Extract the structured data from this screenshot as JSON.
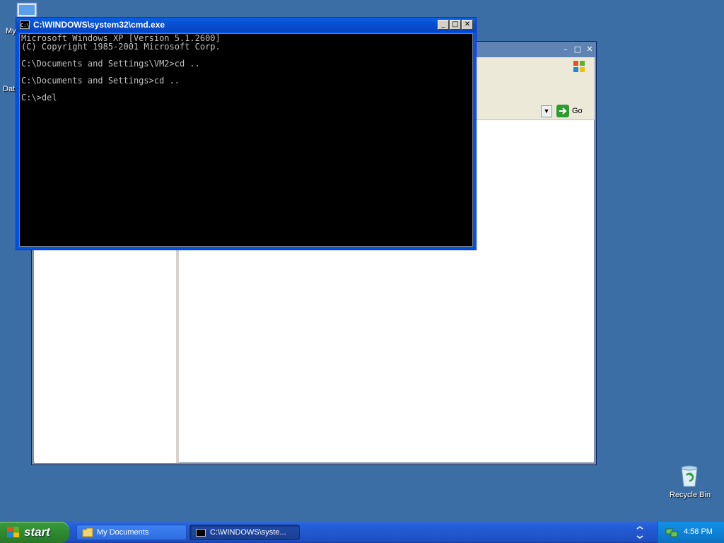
{
  "desktop": {
    "icons": [
      {
        "label": "My"
      },
      {
        "label": "Dat"
      },
      {
        "label": "Recycle Bin"
      }
    ]
  },
  "explorer": {
    "address_go_label": "Go"
  },
  "cmd": {
    "title": "C:\\WINDOWS\\system32\\cmd.exe",
    "icon_text": "C:\\",
    "lines": [
      "Microsoft Windows XP [Version 5.1.2600]",
      "(C) Copyright 1985-2001 Microsoft Corp.",
      "",
      "C:\\Documents and Settings\\VM2>cd ..",
      "",
      "C:\\Documents and Settings>cd ..",
      "",
      "C:\\>del"
    ]
  },
  "taskbar": {
    "start_label": "start",
    "tasks": [
      {
        "label": "My Documents"
      },
      {
        "label": "C:\\WINDOWS\\syste..."
      }
    ],
    "clock": "4:58 PM"
  },
  "colors": {
    "desktop_bg": "#3a6ea5",
    "title_bar": "#0054e3",
    "taskbar": "#245edb",
    "start_green": "#2f8a2f",
    "console_text": "#c0c0c0"
  }
}
